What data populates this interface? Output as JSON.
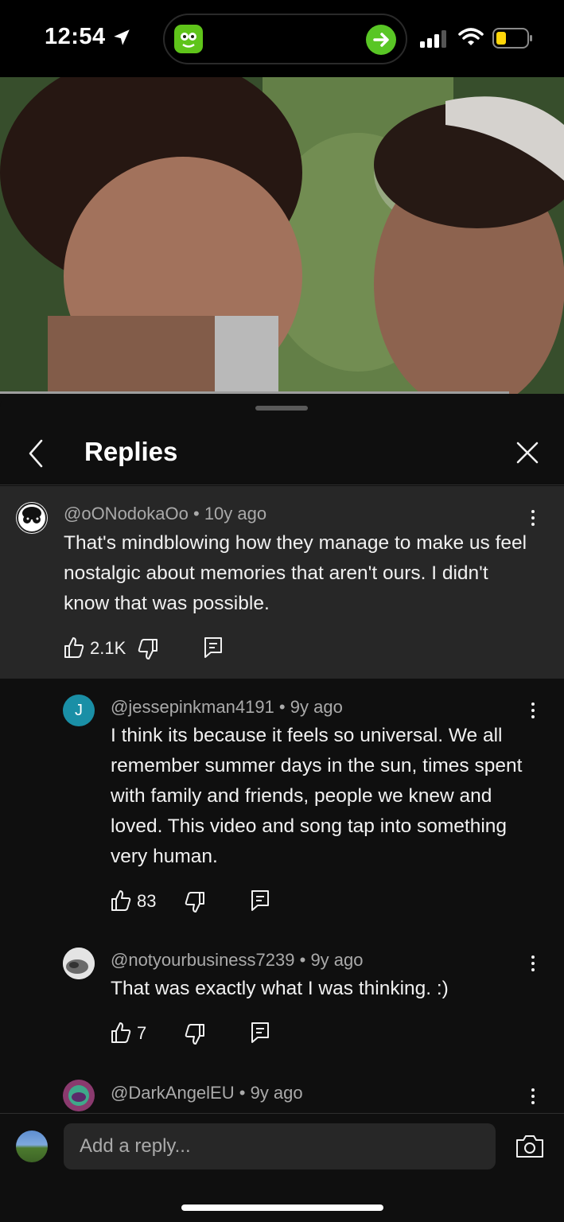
{
  "status_bar": {
    "time": "12:54"
  },
  "header": {
    "title": "Replies"
  },
  "parent_comment": {
    "author": "@oONodokaOo",
    "age": "10y ago",
    "text": "That's mindblowing how they manage to make us feel nostalgic about memories that aren't ours. I didn't know that was possible.",
    "likes": "2.1K"
  },
  "replies": [
    {
      "author": "@jessepinkman4191",
      "age": "9y ago",
      "avatar_letter": "J",
      "avatar_color": "#1a8fa6",
      "text": "I think its because it feels so universal. We all remember summer days in the sun, times spent with family and friends, people we knew and loved. This video and song tap into something very human.",
      "likes": "83"
    },
    {
      "author": "@notyourbusiness7239",
      "age": "9y ago",
      "text": "That was exactly what I was thinking. :)",
      "likes": "7"
    },
    {
      "author": "@DarkAngelEU",
      "age": "9y ago"
    }
  ],
  "separator": "•",
  "composer": {
    "placeholder": "Add a reply..."
  },
  "colors": {
    "background": "#0f0f0f",
    "highlight": "#272727",
    "secondary_text": "#aaaaaa",
    "accent_green": "#59c625"
  }
}
